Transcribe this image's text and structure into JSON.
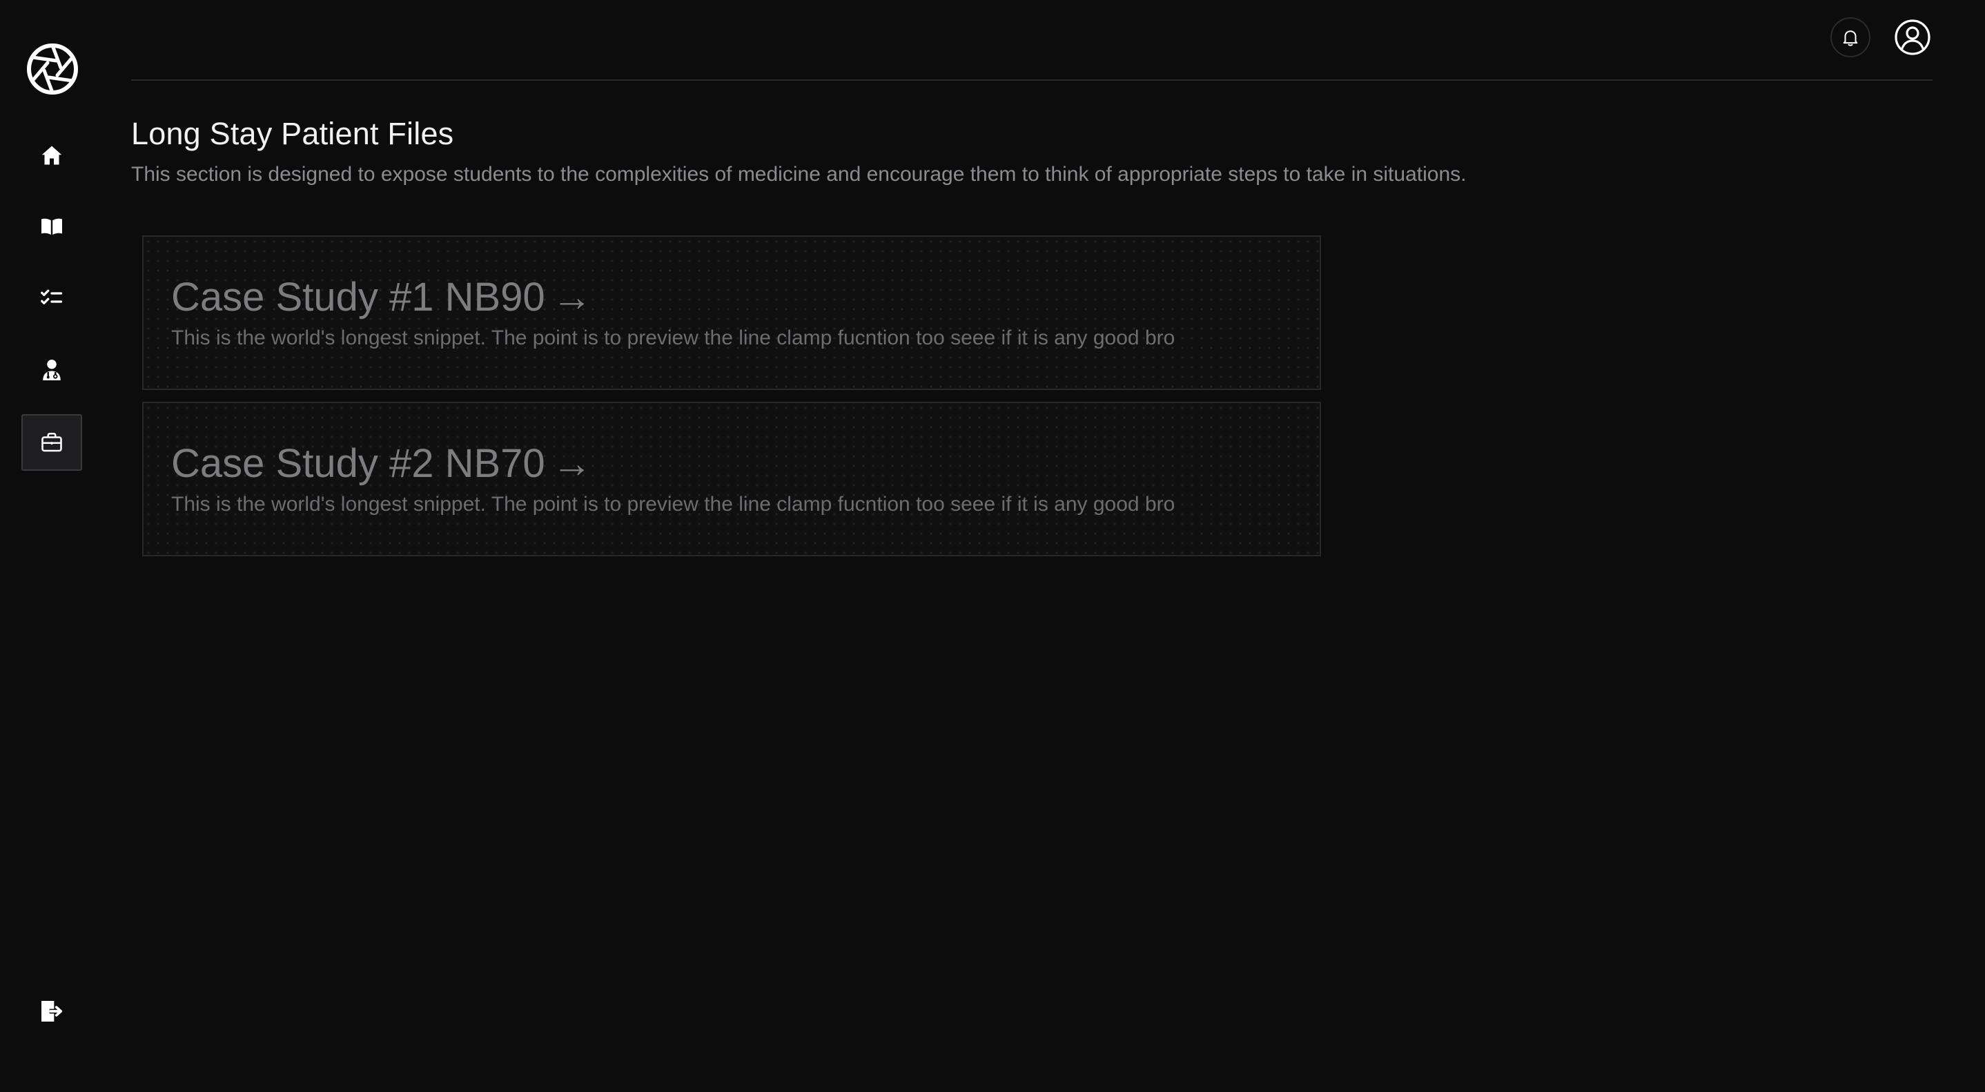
{
  "header": {
    "notifications_icon": "bell-icon",
    "account_icon": "user-circle-icon"
  },
  "sidebar": {
    "logo_icon": "aperture-icon",
    "items": [
      {
        "id": "home",
        "icon": "home-icon"
      },
      {
        "id": "library",
        "icon": "book-open-icon"
      },
      {
        "id": "checklist",
        "icon": "checklist-icon"
      },
      {
        "id": "doctor",
        "icon": "doctor-icon"
      },
      {
        "id": "cases",
        "icon": "briefcase-icon",
        "active": true
      }
    ],
    "logout_icon": "logout-icon"
  },
  "page": {
    "title": "Long Stay Patient Files",
    "subtitle": "This section is designed to expose students to the complexities of medicine and encourage them to think of appropriate steps to take in situations."
  },
  "cases": [
    {
      "title": "Case Study #1 NB90",
      "arrow": "→",
      "snippet": "This is the world's longest snippet. The point is to preview the line clamp fucntion too seee if it is any good bro"
    },
    {
      "title": "Case Study #2 NB70",
      "arrow": "→",
      "snippet": "This is the world's longest snippet. The point is to preview the line clamp fucntion too seee if it is any good bro"
    }
  ],
  "colors": {
    "background": "#0c0c0d",
    "title_text": "#f2f2f2",
    "muted_text": "#8c8c90",
    "card_border": "#29292b"
  }
}
